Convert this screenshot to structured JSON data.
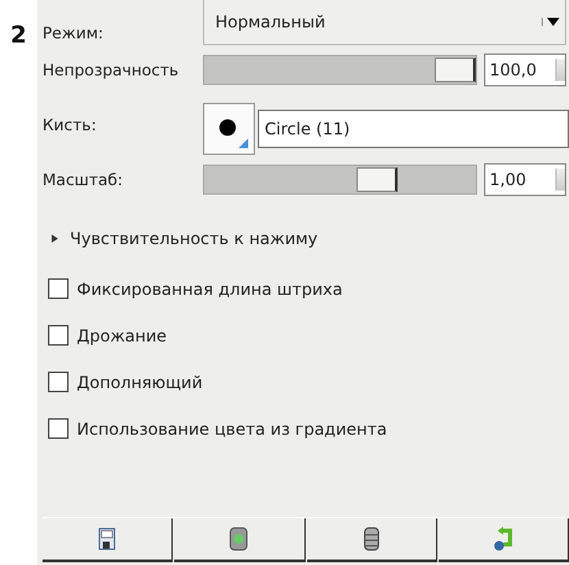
{
  "marker": "2",
  "mode": {
    "label": "Режим:",
    "value": "Нормальный"
  },
  "opacity": {
    "label": "Непрозрачность",
    "level": 1,
    "value": "100,0"
  },
  "brush": {
    "label": "Кисть:",
    "value": "Circle (11)"
  },
  "scale": {
    "label": "Масштаб:",
    "level": 0.66,
    "value": "1,00"
  },
  "pressure": {
    "label": "Чувствительность к нажиму",
    "expanded": false
  },
  "options": [
    {
      "label": "Фиксированная длина штриха",
      "checked": false
    },
    {
      "label": "Дрожание",
      "checked": false
    },
    {
      "label": "Дополняющий",
      "checked": false
    },
    {
      "label": "Использование цвета из градиента",
      "checked": false
    }
  ],
  "buttons": [
    {
      "kind": "save"
    },
    {
      "kind": "restore"
    },
    {
      "kind": "delete"
    },
    {
      "kind": "reset"
    }
  ]
}
